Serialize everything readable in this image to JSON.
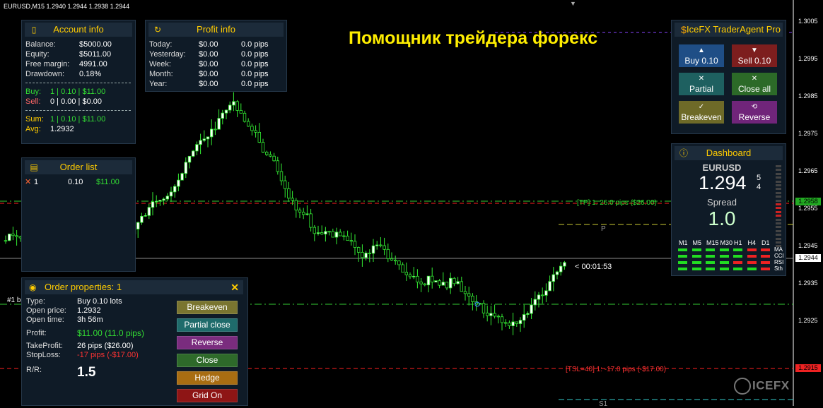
{
  "symbol_header": "EURUSD,M15  1.2940 1.2944 1.2938 1.2944",
  "headline": "Помощник трейдера форекс",
  "price_axis": [
    "1.3005",
    "1.2995",
    "1.2985",
    "1.2975",
    "1.2965",
    "1.2955",
    "1.2945",
    "1.2935",
    "1.2925"
  ],
  "price_tags": {
    "tp": "1.2958",
    "bid": "1.2944",
    "sl": "1.2915"
  },
  "chart_lines": {
    "tp_label": "[TP] 1: 26.0 pips ($26.00)",
    "sl_label": "[TSL=40] 1: -17.0 pips (-$17.00)",
    "timer": "< 00:01:53",
    "pivot_p": "P",
    "pivot_s1": "S1",
    "order_tag": "#1 b"
  },
  "account_info": {
    "title": "Account info",
    "balance_label": "Balance:",
    "balance": "$5000.00",
    "equity_label": "Equity:",
    "equity": "$5011.00",
    "free_margin_label": "Free margin:",
    "free_margin": "4991.00",
    "drawdown_label": "Drawdown:",
    "drawdown": "0.18%",
    "buy_label": "Buy:",
    "buy": "1 | 0.10 | $11.00",
    "sell_label": "Sell:",
    "sell": "0 | 0.00 | $0.00",
    "sum_label": "Sum:",
    "sum": "1 | 0.10 | $11.00",
    "avg_label": "Avg:",
    "avg": "1.2932"
  },
  "profit_info": {
    "title": "Profit info",
    "rows": [
      {
        "label": "Today:",
        "money": "$0.00",
        "pips": "0.0 pips"
      },
      {
        "label": "Yesterday:",
        "money": "$0.00",
        "pips": "0.0 pips"
      },
      {
        "label": "Week:",
        "money": "$0.00",
        "pips": "0.0 pips"
      },
      {
        "label": "Month:",
        "money": "$0.00",
        "pips": "0.0 pips"
      },
      {
        "label": "Year:",
        "money": "$0.00",
        "pips": "0.0 pips"
      }
    ]
  },
  "order_list": {
    "title": "Order list",
    "items": [
      {
        "ticket": "1",
        "lots": "0.10",
        "profit": "$11.00"
      }
    ]
  },
  "order_props": {
    "title": "Order properties: 1",
    "type_label": "Type:",
    "type": "Buy  0.10 lots",
    "open_price_label": "Open price:",
    "open_price": "1.2932",
    "open_time_label": "Open time:",
    "open_time": "3h 56m",
    "profit_label": "Profit:",
    "profit": "$11.00 (11.0 pips)",
    "tp_label": "TakeProfit:",
    "tp": "26 pips ($26.00)",
    "sl_label": "StopLoss:",
    "sl": "-17 pips (-$17.00)",
    "rr_label": "R/R:",
    "rr": "1.5",
    "buttons": [
      "Breakeven",
      "Partial close",
      "Reverse",
      "Close",
      "Hedge",
      "Grid On"
    ]
  },
  "trader_agent": {
    "title": "IceFX TraderAgent Pro",
    "buy": "Buy 0.10",
    "sell": "Sell 0.10",
    "partial": "Partial",
    "close_all": "Close all",
    "breakeven": "Breakeven",
    "reverse": "Reverse"
  },
  "dashboard": {
    "title": "Dashboard",
    "symbol": "EURUSD",
    "price_main": "1.294",
    "price_sup": "5",
    "price_sub": "4",
    "spread_label": "Spread",
    "spread": "1.0",
    "timeframes": [
      "M1",
      "M5",
      "M15",
      "M30",
      "H1",
      "H4",
      "D1"
    ],
    "indicators": [
      "MA",
      "CCI",
      "RSI",
      "Sth"
    ],
    "signal_colors": {
      "up": "#22dd22",
      "down": "#ee2222"
    }
  },
  "watermark": "ICEFX"
}
